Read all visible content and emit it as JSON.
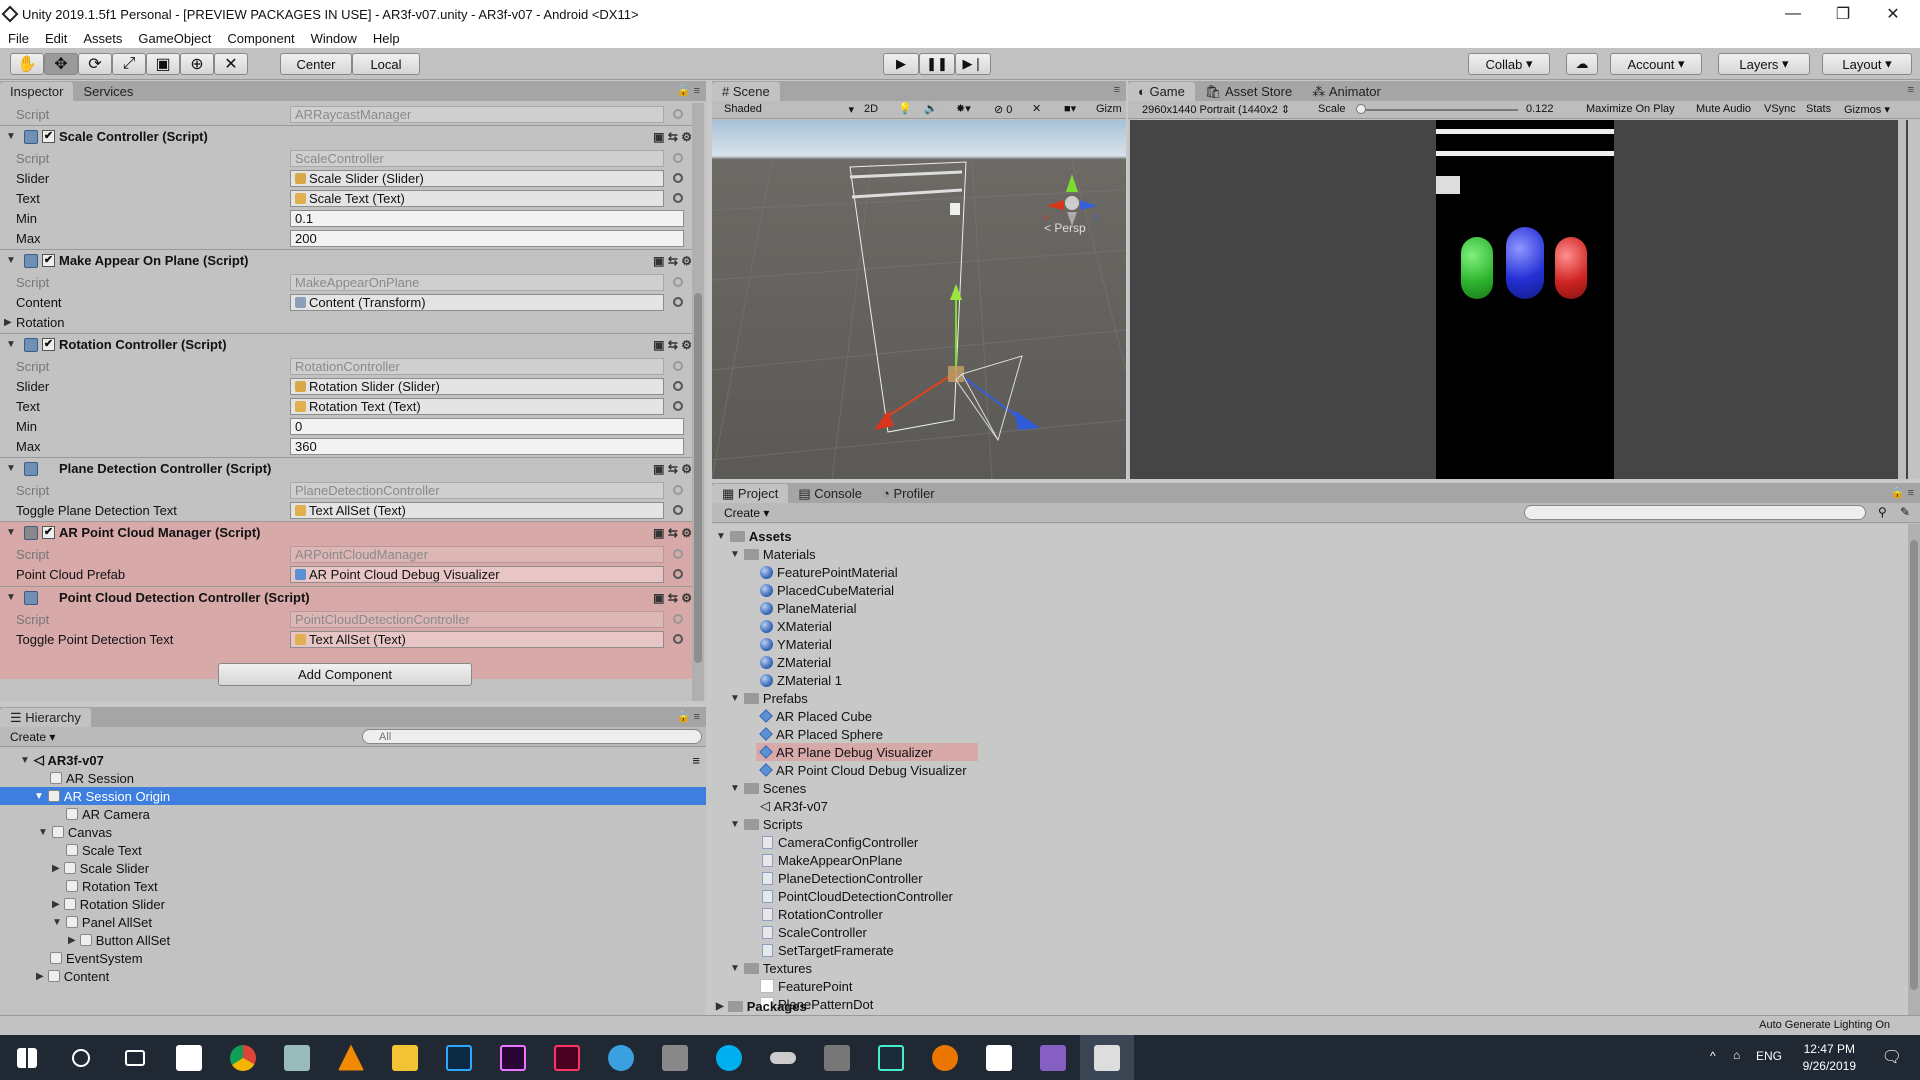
{
  "window": {
    "title": "Unity 2019.1.5f1 Personal - [PREVIEW PACKAGES IN USE] - AR3f-v07.unity - AR3f-v07 - Android <DX11>",
    "minimize": "—",
    "maximize": "❐",
    "close": "✕"
  },
  "menu": [
    "File",
    "Edit",
    "Assets",
    "GameObject",
    "Component",
    "Window",
    "Help"
  ],
  "toolbar": {
    "center_label": "Center",
    "local_label": "Local",
    "collab_label": "Collab",
    "account_label": "Account",
    "layers_label": "Layers",
    "layout_label": "Layout"
  },
  "inspector": {
    "tabs": [
      "Inspector",
      "Services"
    ],
    "top_script_value": "ARRaycastManager",
    "components": [
      {
        "name": "Scale Controller (Script)",
        "rows": [
          {
            "label": "Script",
            "value": "ScaleController"
          },
          {
            "label": "Slider",
            "value": "Scale Slider (Slider)"
          },
          {
            "label": "Text",
            "value": "Scale Text (Text)"
          },
          {
            "label": "Min",
            "value": "0.1"
          },
          {
            "label": "Max",
            "value": "200"
          }
        ]
      },
      {
        "name": "Make Appear On Plane (Script)",
        "rows": [
          {
            "label": "Script",
            "value": "MakeAppearOnPlane"
          },
          {
            "label": "Content",
            "value": "Content (Transform)"
          },
          {
            "label": "Rotation",
            "value": ""
          }
        ]
      },
      {
        "name": "Rotation Controller (Script)",
        "rows": [
          {
            "label": "Script",
            "value": "RotationController"
          },
          {
            "label": "Slider",
            "value": "Rotation Slider (Slider)"
          },
          {
            "label": "Text",
            "value": "Rotation Text (Text)"
          },
          {
            "label": "Min",
            "value": "0"
          },
          {
            "label": "Max",
            "value": "360"
          }
        ]
      },
      {
        "name": "Plane Detection Controller (Script)",
        "rows": [
          {
            "label": "Script",
            "value": "PlaneDetectionController"
          },
          {
            "label": "Toggle Plane Detection Text",
            "value": "Text AllSet (Text)"
          }
        ]
      },
      {
        "name": "AR Point Cloud Manager (Script)",
        "rows": [
          {
            "label": "Script",
            "value": "ARPointCloudManager"
          },
          {
            "label": "Point Cloud Prefab",
            "value": "AR Point Cloud Debug Visualizer"
          }
        ]
      },
      {
        "name": "Point Cloud Detection Controller (Script)",
        "rows": [
          {
            "label": "Script",
            "value": "PointCloudDetectionController"
          },
          {
            "label": "Toggle Point Detection Text",
            "value": "Text AllSet (Text)"
          }
        ]
      }
    ],
    "add_component_label": "Add Component"
  },
  "hierarchy": {
    "tab": "Hierarchy",
    "create_label": "Create",
    "search_placeholder": "All",
    "items": [
      "AR3f-v07",
      "AR Session",
      "AR Session Origin",
      "AR Camera",
      "Canvas",
      "Scale Text",
      "Scale Slider",
      "Rotation Text",
      "Rotation Slider",
      "Panel AllSet",
      "Button AllSet",
      "EventSystem",
      "Content"
    ]
  },
  "scene": {
    "tab": "Scene",
    "shading": "Shaded",
    "mode_2d": "2D",
    "hidden_count": "0",
    "gizmos": "Gizm",
    "persp": "< Persp"
  },
  "game": {
    "tabs": [
      "Game",
      "Asset Store",
      "Animator"
    ],
    "resolution": "2960x1440 Portrait (1440x2",
    "scale_label": "Scale",
    "scale_value": "0.122",
    "maximize": "Maximize On Play",
    "mute": "Mute Audio",
    "vsync": "VSync",
    "stats": "Stats",
    "gizmos": "Gizmos",
    "capsule_colors": [
      "#2fb52f",
      "#2430d6",
      "#d02424"
    ]
  },
  "project": {
    "tabs": [
      "Project",
      "Console",
      "Profiler"
    ],
    "create_label": "Create",
    "assets_label": "Assets",
    "materials_label": "Materials",
    "materials": [
      "FeaturePointMaterial",
      "PlacedCubeMaterial",
      "PlaneMaterial",
      "XMaterial",
      "YMaterial",
      "ZMaterial",
      "ZMaterial 1"
    ],
    "prefabs_label": "Prefabs",
    "prefabs": [
      "AR Placed Cube",
      "AR Placed Sphere",
      "AR Plane Debug Visualizer",
      "AR Point Cloud Debug Visualizer"
    ],
    "scenes_label": "Scenes",
    "scenes": [
      "AR3f-v07"
    ],
    "scripts_label": "Scripts",
    "scripts": [
      "CameraConfigController",
      "MakeAppearOnPlane",
      "PlaneDetectionController",
      "PointCloudDetectionController",
      "RotationController",
      "ScaleController",
      "SetTargetFramerate"
    ],
    "textures_label": "Textures",
    "textures": [
      "FeaturePoint",
      "PlanePatternDot"
    ],
    "packages_label": "Packages"
  },
  "status": {
    "right": "Auto Generate Lighting On"
  },
  "taskbar": {
    "lang": "ENG",
    "time": "12:47 PM",
    "date": "9/26/2019"
  }
}
